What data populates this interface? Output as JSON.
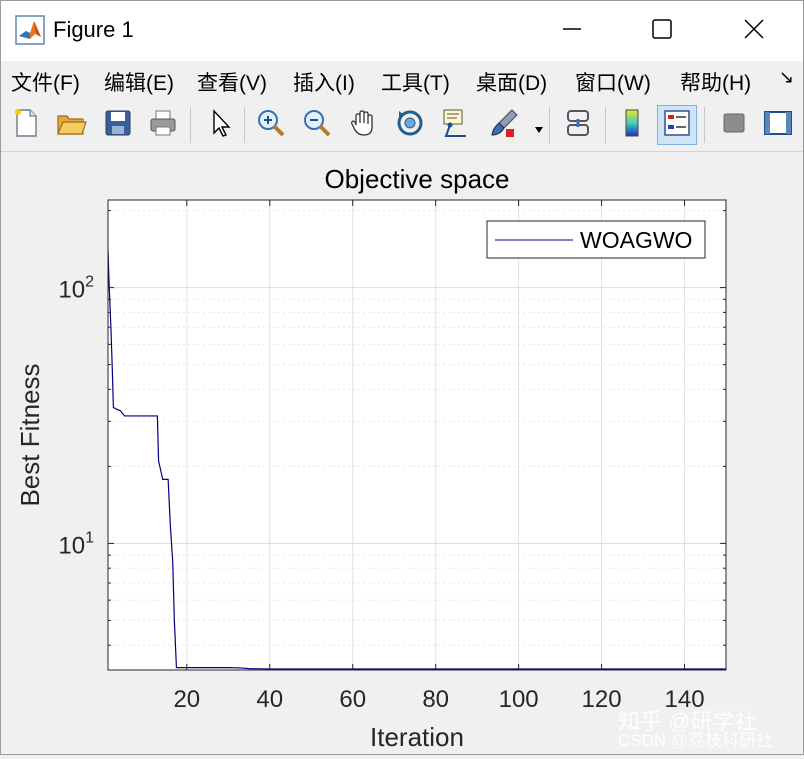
{
  "window": {
    "title": "Figure 1",
    "icons": [
      "matlab-logo-icon",
      "minimize-icon",
      "maximize-icon",
      "close-icon"
    ]
  },
  "menu": {
    "items": [
      "文件(F)",
      "编辑(E)",
      "查看(V)",
      "插入(I)",
      "工具(T)",
      "桌面(D)",
      "窗口(W)",
      "帮助(H)"
    ],
    "overflow_glyph": "↘"
  },
  "toolbar": {
    "icons": [
      "new-figure-icon",
      "open-file-icon",
      "save-icon",
      "print-icon",
      "edit-plot-arrow-icon",
      "zoom-in-icon",
      "zoom-out-icon",
      "pan-hand-icon",
      "rotate-3d-icon",
      "data-cursor-icon",
      "brush-icon",
      "link-plot-icon",
      "colorbar-icon",
      "legend-icon",
      "hide-plot-tools-icon",
      "show-plot-tools-icon"
    ],
    "active": "legend-icon"
  },
  "chart_data": {
    "type": "line",
    "title": "Objective space",
    "xlabel": "Iteration",
    "ylabel": "Best Fitness",
    "yscale": "log",
    "xlim": [
      1,
      150
    ],
    "ylim": [
      3.2,
      220
    ],
    "xticks": [
      20,
      40,
      60,
      80,
      100,
      120,
      140
    ],
    "xtick_labels": [
      "20",
      "40",
      "60",
      "80",
      "100",
      "120",
      "140"
    ],
    "yticks": [
      10,
      100
    ],
    "ytick_labels": [
      {
        "base": "10",
        "exp": "1"
      },
      {
        "base": "10",
        "exp": "2"
      }
    ],
    "grid": true,
    "legend": {
      "position": "top-right",
      "entries": [
        "WOAGWO"
      ]
    },
    "series": [
      {
        "name": "WOAGWO",
        "color": "#000080",
        "x": [
          1,
          1.3,
          1.7,
          2,
          2.3,
          3,
          4,
          5,
          12.9,
          13.2,
          14.2,
          15.5,
          16,
          16.6,
          17,
          17.5,
          30,
          33,
          35,
          40,
          150
        ],
        "y": [
          140,
          100,
          70,
          50,
          34,
          33.5,
          33,
          31.5,
          31.5,
          21,
          17.8,
          17.8,
          12,
          8.5,
          5,
          3.27,
          3.27,
          3.26,
          3.24,
          3.23,
          3.23
        ]
      }
    ]
  },
  "watermark": {
    "line1": "知乎 @研学社",
    "line2": "CSDN @荔枝科研社"
  }
}
